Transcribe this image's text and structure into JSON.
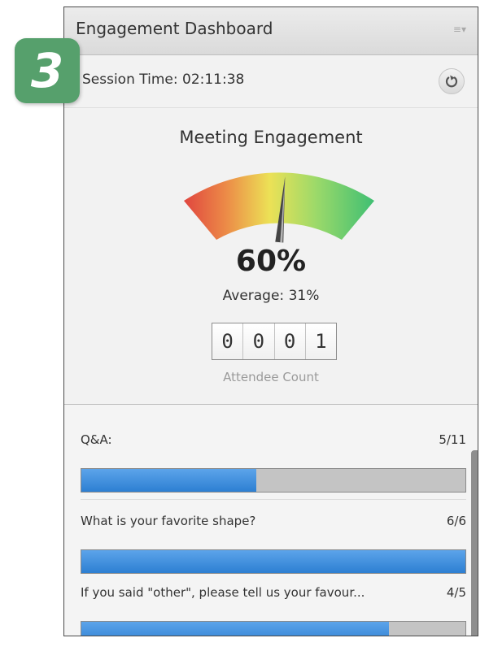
{
  "step_badge": "3",
  "header": {
    "title": "Engagement Dashboard",
    "menu_icon": "menu-lines-icon"
  },
  "session": {
    "label": "Session Time: 02:11:38",
    "refresh_icon": "refresh-icon"
  },
  "engagement": {
    "title": "Meeting Engagement",
    "percent": "60%",
    "average": "Average: 31%",
    "gauge_value": 0.6
  },
  "attendees": {
    "digits": [
      "0",
      "0",
      "0",
      "1"
    ],
    "label": "Attendee Count"
  },
  "items": [
    {
      "name": "Q&A:",
      "value": "5/11",
      "fraction": 0.4545
    },
    {
      "name": "What is your favorite shape?",
      "value": "6/6",
      "fraction": 1.0
    },
    {
      "name": "If you said \"other\", please tell us your favour...",
      "value": "4/5",
      "fraction": 0.8
    }
  ],
  "colors": {
    "accent": "#2d7fd2",
    "badge": "#56a06c",
    "gauge_low": "#e0463f",
    "gauge_mid": "#e9de55",
    "gauge_high": "#56c77a"
  }
}
